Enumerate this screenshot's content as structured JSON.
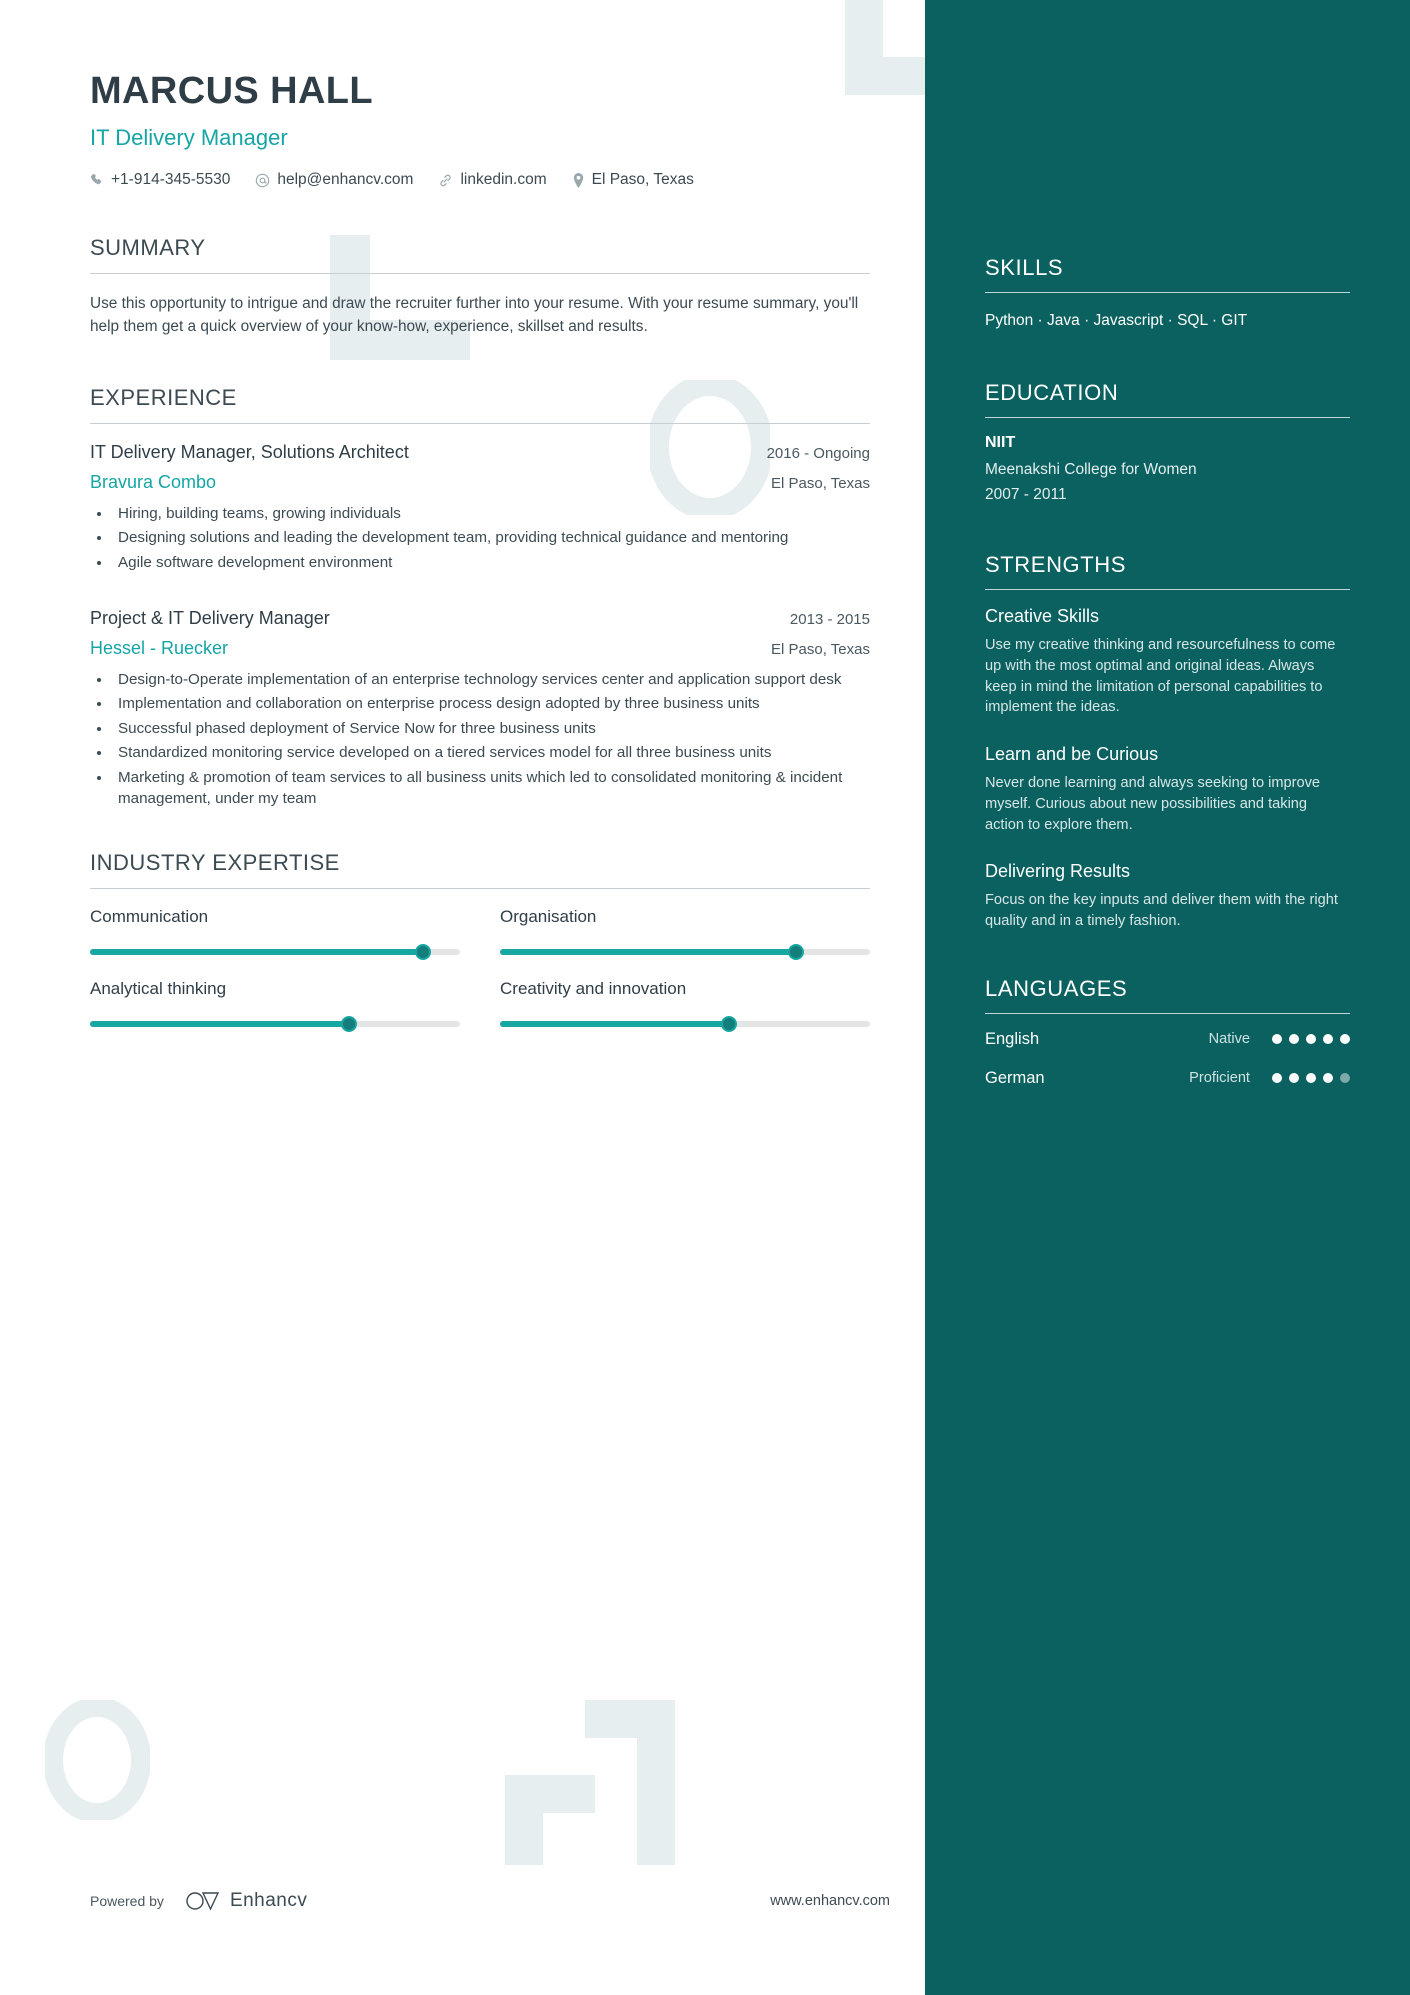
{
  "header": {
    "name": "MARCUS HALL",
    "job_title": "IT Delivery Manager",
    "contacts": [
      {
        "icon": "phone-icon",
        "text": "+1-914-345-5530"
      },
      {
        "icon": "email-icon",
        "text": "help@enhancv.com"
      },
      {
        "icon": "link-icon",
        "text": "linkedin.com"
      },
      {
        "icon": "location-pin-icon",
        "text": "El Paso, Texas"
      }
    ]
  },
  "summary": {
    "heading": "SUMMARY",
    "text": "Use this opportunity to intrigue and draw the recruiter further into your resume. With your resume summary, you'll help them get a quick overview of your know-how, experience, skillset and results."
  },
  "experience": {
    "heading": "EXPERIENCE",
    "jobs": [
      {
        "role": "IT Delivery Manager, Solutions Architect",
        "date": "2016 - Ongoing",
        "company": "Bravura Combo",
        "location": "El Paso, Texas",
        "bullets": [
          "Hiring, building teams, growing individuals",
          "Designing solutions and leading the development team, providing technical guidance and mentoring",
          "Agile software development environment"
        ]
      },
      {
        "role": "Project & IT Delivery Manager",
        "date": "2013 - 2015",
        "company": "Hessel - Ruecker",
        "location": "El Paso, Texas",
        "bullets": [
          "Design-to-Operate implementation of an enterprise technology services center and application support desk",
          "Implementation and collaboration on enterprise process design adopted by three business units",
          "Successful phased deployment of Service Now for three business units",
          "Standardized monitoring service developed on a tiered services model for all three business units",
          "Marketing & promotion of team services to all business units which led to consolidated monitoring & incident management, under my team"
        ]
      }
    ]
  },
  "industry_expertise": {
    "heading": "INDUSTRY EXPERTISE",
    "items": [
      {
        "label": "Communication",
        "value": 90
      },
      {
        "label": "Organisation",
        "value": 80
      },
      {
        "label": "Analytical thinking",
        "value": 70
      },
      {
        "label": "Creativity and innovation",
        "value": 62
      }
    ]
  },
  "skills": {
    "heading": "SKILLS",
    "list": "Python · Java · Javascript · SQL · GIT"
  },
  "education": {
    "heading": "EDUCATION",
    "school": "NIIT",
    "degree": "Meenakshi College for Women",
    "years": "2007 - 2011"
  },
  "strengths": {
    "heading": "STRENGTHS",
    "items": [
      {
        "title": "Creative Skills",
        "text": "Use my creative thinking and resourcefulness to come up with the most optimal and original ideas. Always keep in mind the limitation of personal capabilities to implement the ideas."
      },
      {
        "title": "Learn and be Curious",
        "text": "Never done learning and always seeking to improve myself. Curious about new possibilities and taking action to explore them."
      },
      {
        "title": "Delivering Results",
        "text": "Focus on the key inputs and deliver them with the right quality and in a timely fashion."
      }
    ]
  },
  "languages": {
    "heading": "LANGUAGES",
    "items": [
      {
        "name": "English",
        "level": "Native",
        "dots": 5,
        "total": 5
      },
      {
        "name": "German",
        "level": "Proficient",
        "dots": 4,
        "total": 5
      }
    ]
  },
  "footer": {
    "powered_by": "Powered by",
    "brand": "Enhancv",
    "website": "www.enhancv.com"
  },
  "colors": {
    "sidebar_bg": "#0a6160",
    "accent": "#16a5a5",
    "slider_fill": "#18a6a2",
    "text_dark": "#3c4a52",
    "watermark": "#e7eef0"
  }
}
